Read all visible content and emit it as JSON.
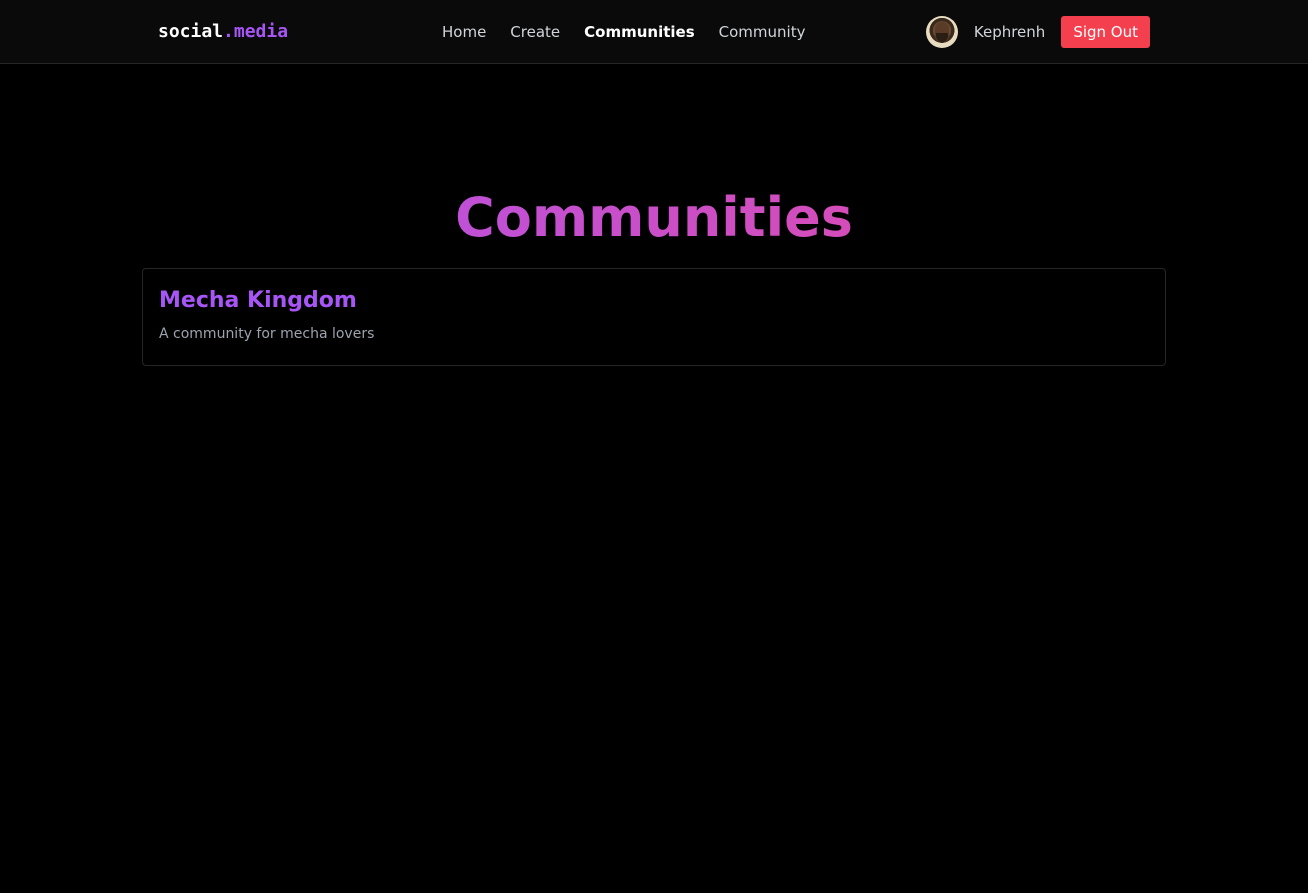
{
  "brand": {
    "name": "social",
    "suffix": ".media"
  },
  "nav": {
    "items": [
      {
        "label": "Home"
      },
      {
        "label": "Create"
      },
      {
        "label": "Communities",
        "active": true
      },
      {
        "label": "Community"
      }
    ]
  },
  "user": {
    "username": "Kephrenh",
    "sign_out_label": "Sign Out"
  },
  "page": {
    "title": "Communities"
  },
  "communities": [
    {
      "name": "Mecha Kingdom",
      "description": "A community for mecha lovers"
    }
  ],
  "colors": {
    "background": "#000000",
    "accent": "#a855f7",
    "title_gradient_end": "#ec4899",
    "sign_out": "#f43f4e"
  }
}
